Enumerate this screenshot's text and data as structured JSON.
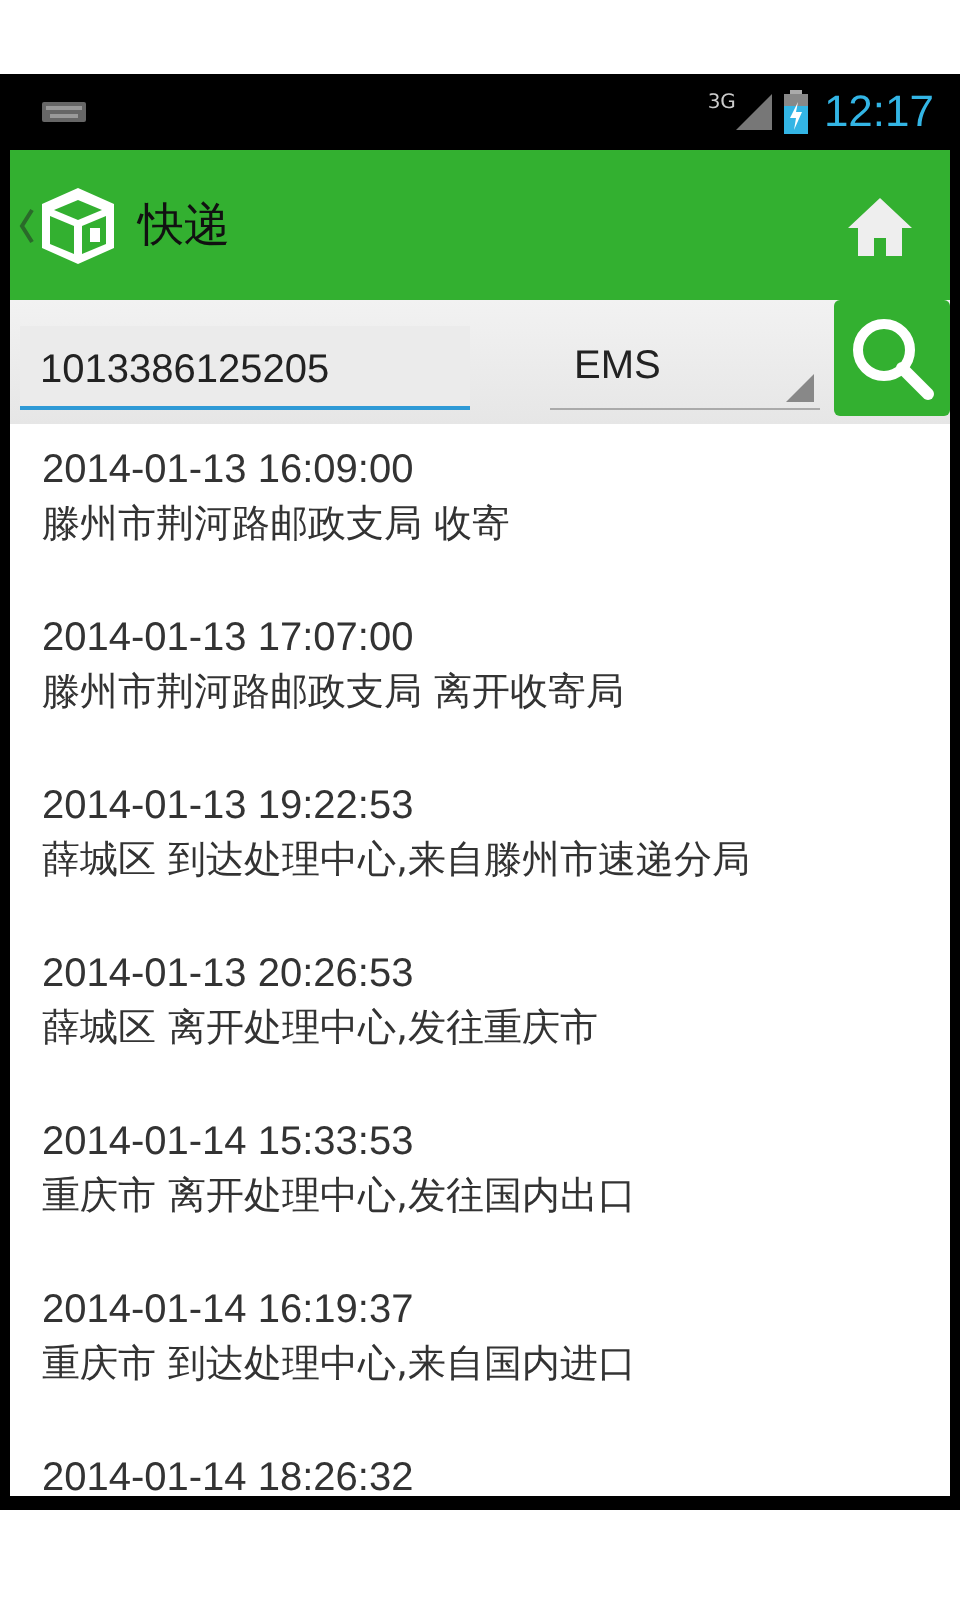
{
  "status_bar": {
    "network": "3G",
    "time": "12:17"
  },
  "action_bar": {
    "title": "快递"
  },
  "search": {
    "tracking_number": "1013386125205",
    "carrier": "EMS"
  },
  "events": [
    {
      "time": "2014-01-13 16:09:00",
      "description": "滕州市荆河路邮政支局 收寄"
    },
    {
      "time": "2014-01-13 17:07:00",
      "description": "滕州市荆河路邮政支局 离开收寄局"
    },
    {
      "time": "2014-01-13 19:22:53",
      "description": "薛城区 到达处理中心,来自滕州市速递分局"
    },
    {
      "time": "2014-01-13 20:26:53",
      "description": "薛城区 离开处理中心,发往重庆市"
    },
    {
      "time": "2014-01-14 15:33:53",
      "description": "重庆市 离开处理中心,发往国内出口"
    },
    {
      "time": "2014-01-14 16:19:37",
      "description": "重庆市 到达处理中心,来自国内进口"
    },
    {
      "time": "2014-01-14 18:26:32"
    }
  ]
}
